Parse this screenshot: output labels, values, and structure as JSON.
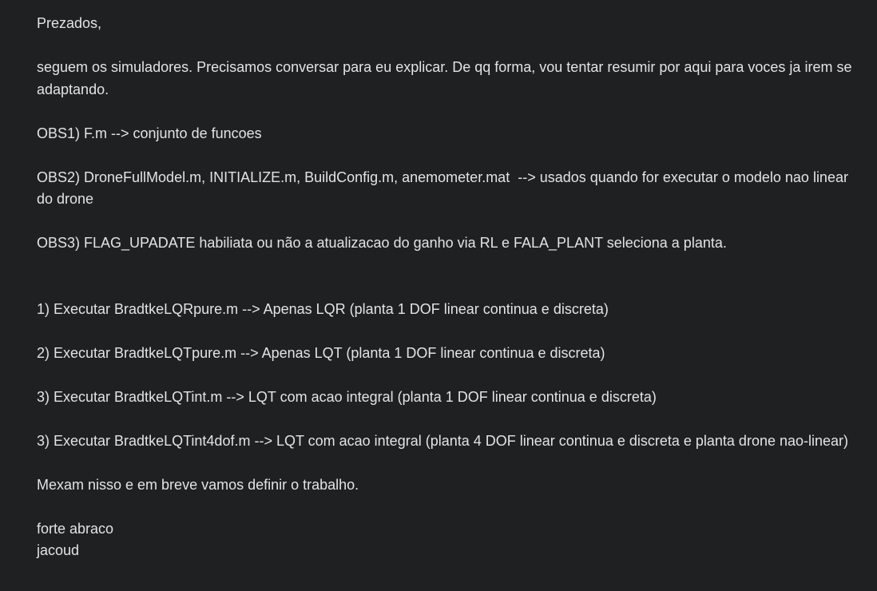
{
  "email": {
    "greeting": "Prezados,",
    "intro": "seguem os simuladores. Precisamos conversar para eu explicar. De qq forma, vou tentar resumir por aqui para voces ja irem se adaptando.",
    "obs1": "OBS1) F.m --> conjunto de funcoes",
    "obs2": "OBS2) DroneFullModel.m, INITIALIZE.m, BuildConfig.m, anemometer.mat  --> usados quando for executar o modelo nao linear do drone",
    "obs3": "OBS3) FLAG_UPADATE habiliata ou não a atualizacao do ganho via RL e FALA_PLANT seleciona a planta.",
    "steps": [
      "1) Executar BradtkeLQRpure.m --> Apenas LQR (planta 1 DOF linear continua e discreta)",
      "2) Executar BradtkeLQTpure.m --> Apenas LQT (planta 1 DOF linear continua e discreta)",
      "3) Executar BradtkeLQTint.m --> LQT com acao integral (planta 1 DOF linear continua e discreta)",
      "3) Executar BradtkeLQTint4dof.m --> LQT com acao integral (planta 4 DOF linear continua e discreta e planta drone nao-linear)"
    ],
    "closing_note": "Mexam nisso e em breve vamos definir o trabalho.",
    "signoff": "forte abraco",
    "signature": "jacoud"
  }
}
